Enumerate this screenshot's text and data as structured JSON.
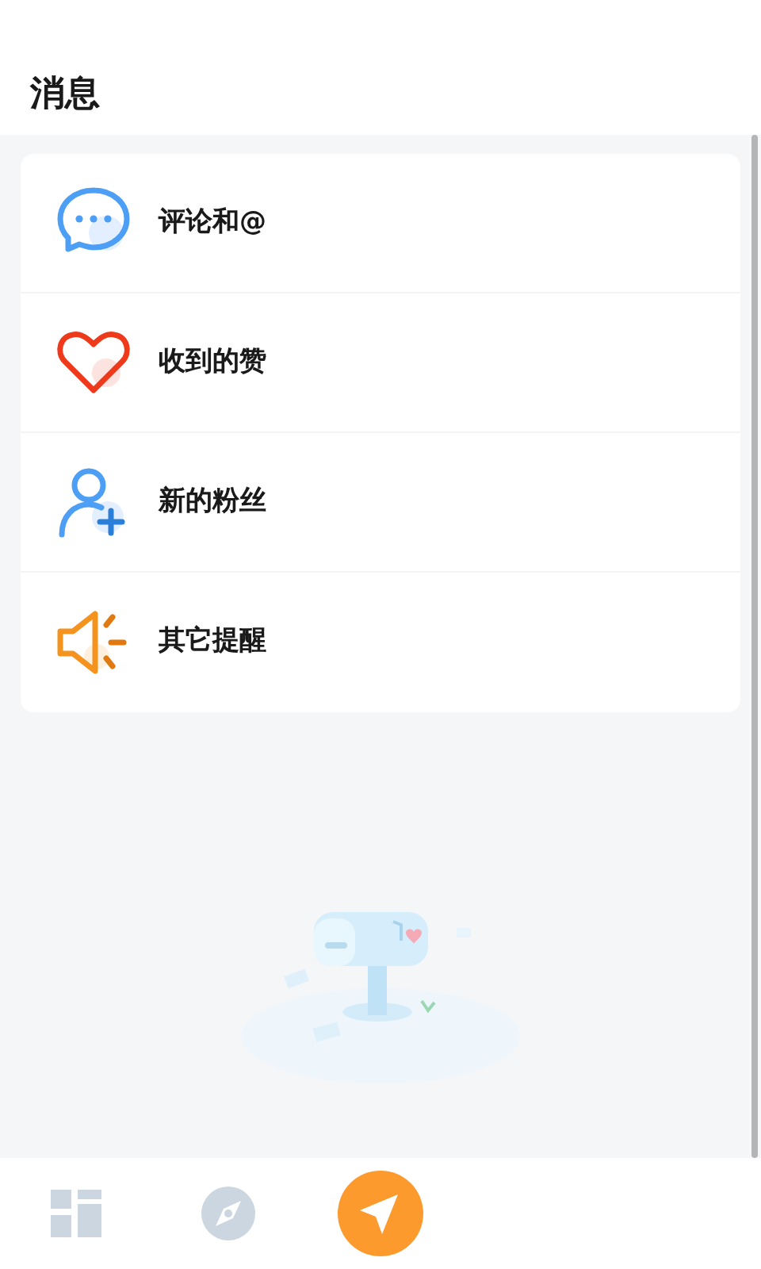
{
  "header": {
    "title": "消息"
  },
  "menu": [
    {
      "kind": "comment",
      "label": "评论和@"
    },
    {
      "kind": "like",
      "label": "收到的赞"
    },
    {
      "kind": "follower",
      "label": "新的粉丝"
    },
    {
      "kind": "notice",
      "label": "其它提醒"
    }
  ],
  "bottom_nav": [
    {
      "kind": "home",
      "selected": false
    },
    {
      "kind": "discover",
      "selected": false
    },
    {
      "kind": "message",
      "selected": true
    }
  ]
}
